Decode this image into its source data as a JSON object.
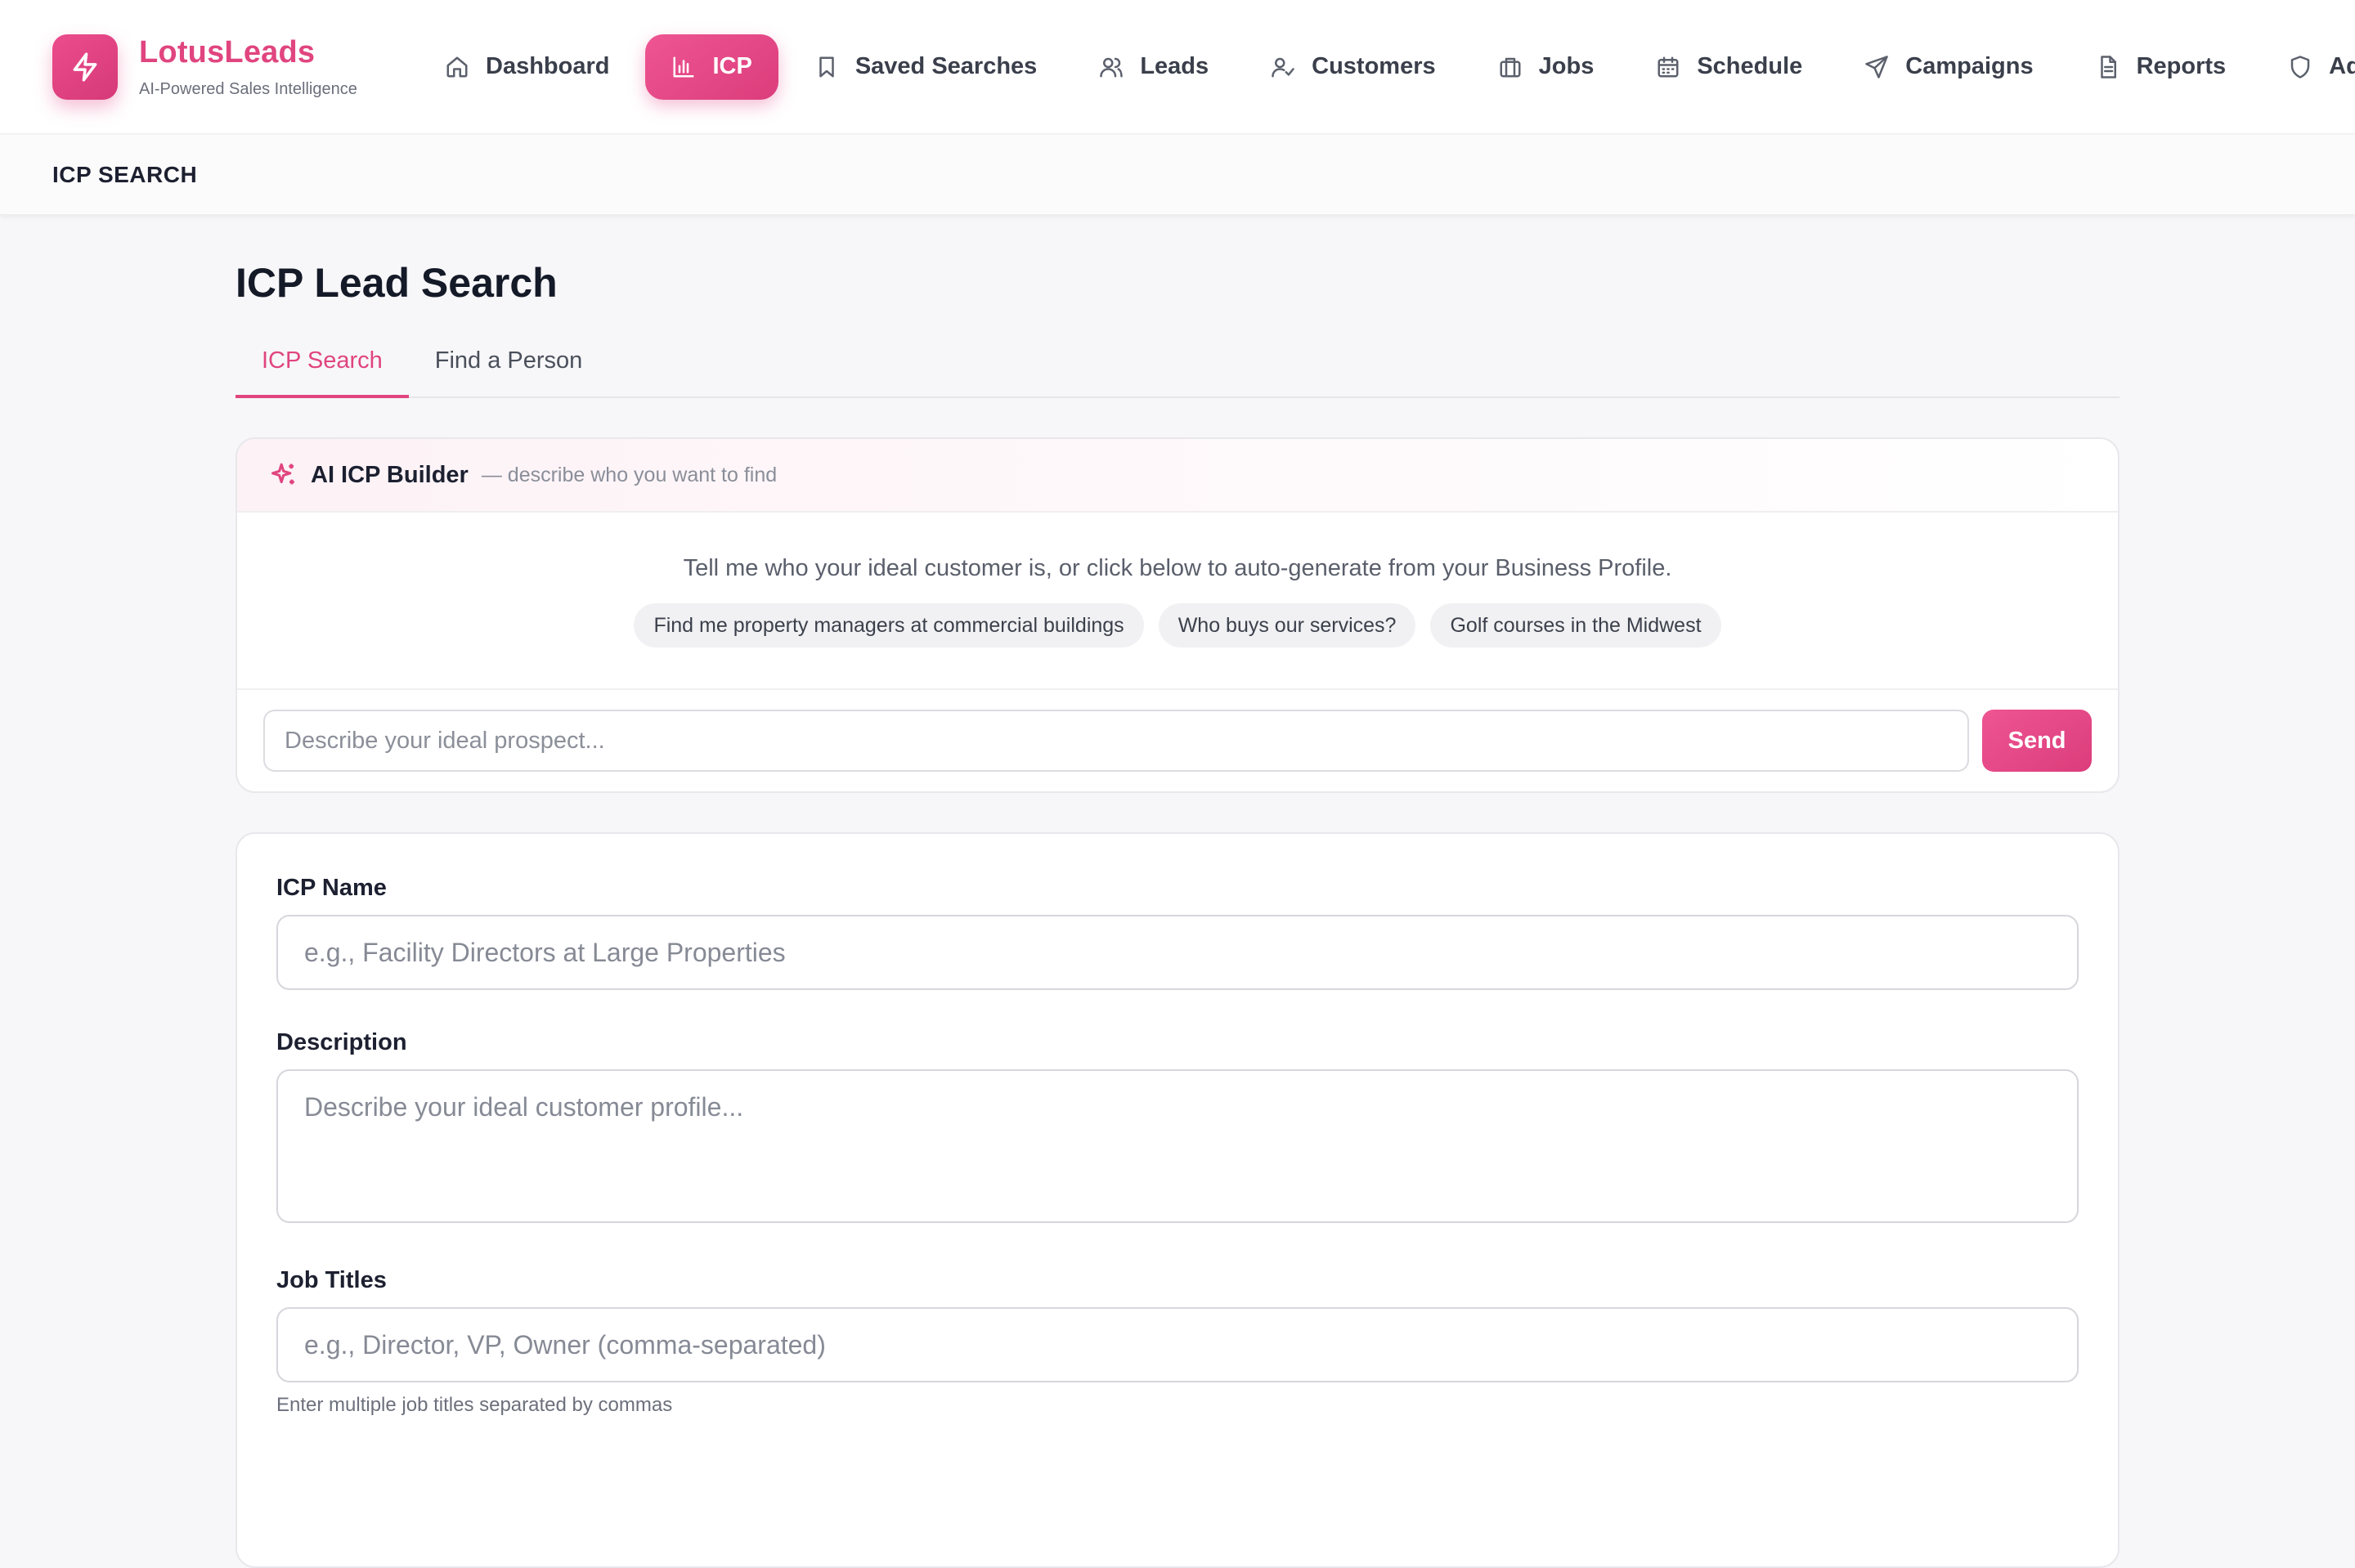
{
  "brand": {
    "name": "LotusLeads",
    "tagline": "AI-Powered Sales Intelligence",
    "logo_icon": "lightning-bolt-icon",
    "accent_color": "#e0457f"
  },
  "nav": {
    "items": [
      {
        "label": "Dashboard",
        "icon": "home-icon"
      },
      {
        "label": "ICP",
        "icon": "bar-chart-icon",
        "active": true
      },
      {
        "label": "Saved Searches",
        "icon": "bookmark-icon"
      },
      {
        "label": "Leads",
        "icon": "users-icon"
      },
      {
        "label": "Customers",
        "icon": "user-check-icon"
      },
      {
        "label": "Jobs",
        "icon": "briefcase-icon"
      },
      {
        "label": "Schedule",
        "icon": "calendar-icon"
      },
      {
        "label": "Campaigns",
        "icon": "send-icon"
      },
      {
        "label": "Reports",
        "icon": "file-text-icon"
      },
      {
        "label": "Ad",
        "icon": "shield-icon"
      }
    ]
  },
  "breadcrumb": "ICP SEARCH",
  "page": {
    "title": "ICP Lead Search",
    "tabs": [
      {
        "label": "ICP Search",
        "active": true
      },
      {
        "label": "Find a Person"
      }
    ]
  },
  "ai_builder": {
    "icon": "sparkles-icon",
    "title": "AI ICP Builder",
    "subtitle": "— describe who you want to find",
    "prompt": "Tell me who your ideal customer is, or click below to auto-generate from your Business Profile.",
    "suggestions": [
      "Find me property managers at commercial buildings",
      "Who buys our services?",
      "Golf courses in the Midwest"
    ],
    "input_placeholder": "Describe your ideal prospect...",
    "send_label": "Send"
  },
  "form": {
    "icp_name": {
      "label": "ICP Name",
      "placeholder": "e.g., Facility Directors at Large Properties"
    },
    "description": {
      "label": "Description",
      "placeholder": "Describe your ideal customer profile..."
    },
    "job_titles": {
      "label": "Job Titles",
      "placeholder": "e.g., Director, VP, Owner (comma-separated)",
      "help": "Enter multiple job titles separated by commas"
    }
  }
}
